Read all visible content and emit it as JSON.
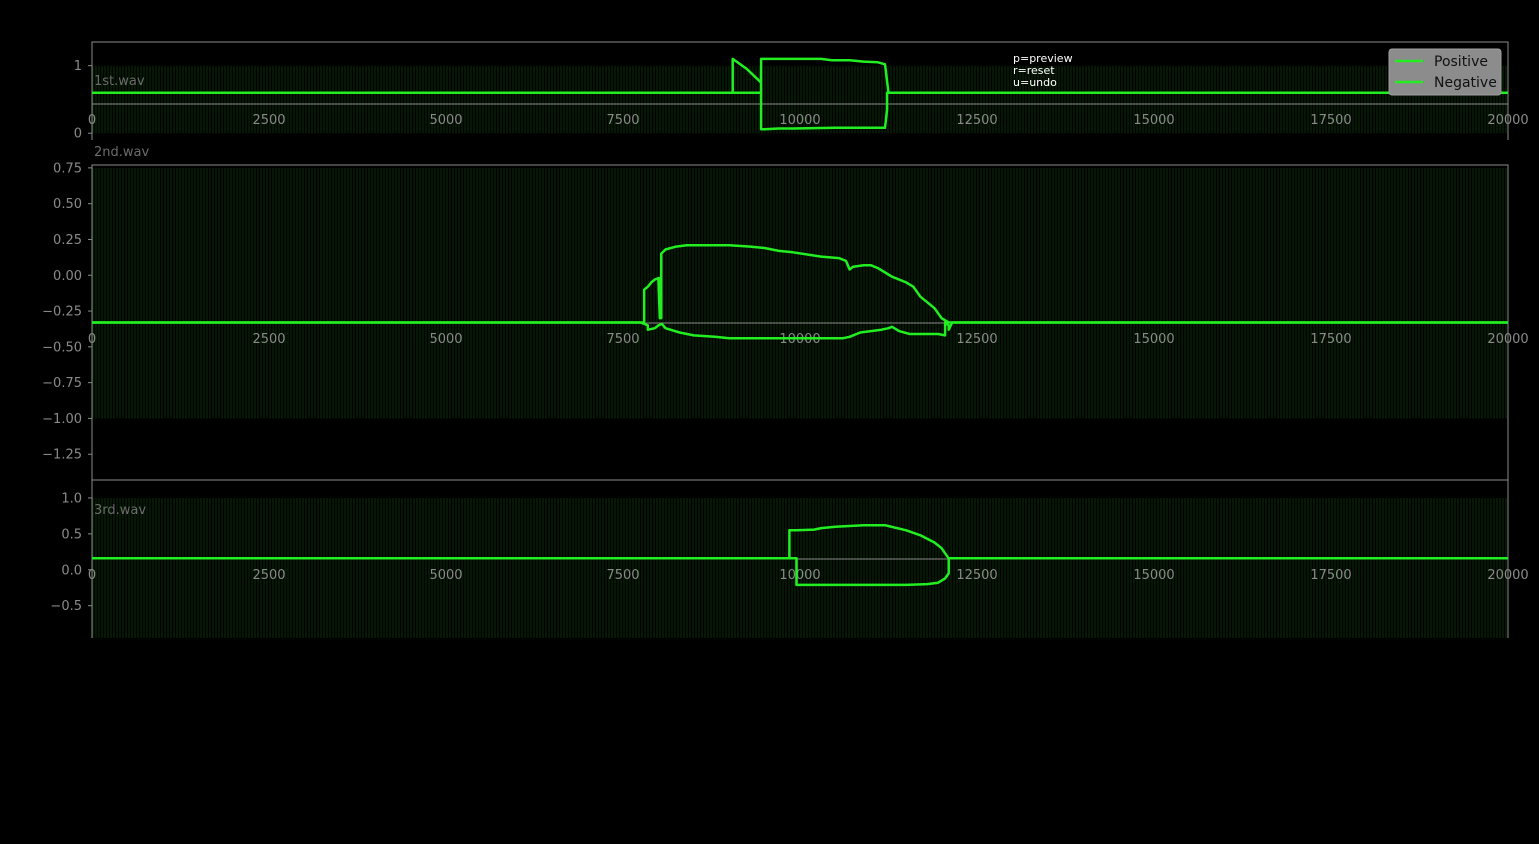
{
  "help_lines": [
    "p=preview",
    "r=reset",
    "u=undo"
  ],
  "colors": {
    "background": "#000000",
    "line": "#22ee22",
    "wave": "#0e5a0e",
    "frame": "#8a8a8a",
    "tick_text": "#8a8a8a",
    "legend_bg": "#8c8c8c"
  },
  "chart_data": [
    {
      "type": "line",
      "title": "1st.wav",
      "x_ticks": [
        0,
        2500,
        5000,
        7500,
        10000,
        12500,
        15000,
        17500,
        20000
      ],
      "x_tick_labels": [
        "0",
        "2500",
        "5000",
        "7500",
        "10000",
        "12500",
        "15000",
        "17500",
        "20000"
      ],
      "y_ticks": [
        1,
        0
      ],
      "y_tick_labels": [
        "1",
        "0"
      ],
      "xlim": [
        0,
        20000
      ],
      "ylim": [
        -0.1,
        1.35
      ],
      "wave_amplitude": [
        0,
        1
      ],
      "legend": {
        "entries": [
          "Positive",
          "Negative"
        ],
        "position": "top-right"
      },
      "series": [
        {
          "name": "Positive",
          "x": [
            0,
            9050,
            9050,
            9250,
            9350,
            9450,
            9450,
            9450,
            9650,
            9650,
            9800,
            9850,
            10300,
            10450,
            10700,
            10900,
            11100,
            11200,
            11250,
            11250,
            11500,
            20000
          ],
          "y": [
            0.6,
            0.6,
            1.1,
            0.95,
            0.85,
            0.75,
            0.6,
            1.1,
            1.1,
            1.1,
            1.1,
            1.1,
            1.1,
            1.08,
            1.08,
            1.06,
            1.05,
            1.02,
            0.6,
            0.6,
            0.6,
            0.6
          ]
        },
        {
          "name": "Negative",
          "x": [
            0,
            9450,
            9450,
            9500,
            9700,
            9900,
            10500,
            11000,
            11200,
            11200,
            11230,
            11230,
            20000
          ],
          "y": [
            0.6,
            0.6,
            0.06,
            0.06,
            0.07,
            0.07,
            0.08,
            0.08,
            0.08,
            0.08,
            0.35,
            0.6,
            0.6
          ]
        }
      ]
    },
    {
      "type": "line",
      "title": "2nd.wav",
      "x_ticks": [
        0,
        2500,
        5000,
        7500,
        10000,
        12500,
        15000,
        17500,
        20000
      ],
      "x_tick_labels": [
        "0",
        "2500",
        "5000",
        "7500",
        "10000",
        "12500",
        "15000",
        "17500",
        "20000"
      ],
      "y_ticks": [
        0.75,
        0.5,
        0.25,
        0.0,
        -0.25,
        -0.5,
        -0.75,
        -1.0,
        -1.25
      ],
      "y_tick_labels": [
        "0.75",
        "0.50",
        "0.25",
        "0.00",
        "−0.25",
        "−0.50",
        "−0.75",
        "−1.00",
        "−1.25"
      ],
      "xlim": [
        0,
        20000
      ],
      "ylim": [
        -1.43,
        0.77
      ],
      "wave_amplitude": [
        -1.0,
        0.75
      ],
      "series": [
        {
          "name": "Positive",
          "x": [
            0,
            7800,
            7800,
            7850,
            7900,
            7950,
            8000,
            8020,
            8020,
            8040,
            8040,
            8100,
            8250,
            8400,
            8800,
            9000,
            9300,
            9500,
            9700,
            9900,
            10300,
            10550,
            10600,
            10650,
            10700,
            10750,
            10900,
            11000,
            11100,
            11300,
            11450,
            11500,
            11600,
            11700,
            11900,
            12000,
            12100,
            12150,
            20000
          ],
          "y": [
            -0.33,
            -0.33,
            -0.1,
            -0.08,
            -0.05,
            -0.03,
            -0.02,
            -0.3,
            -0.02,
            -0.3,
            0.15,
            0.18,
            0.2,
            0.21,
            0.21,
            0.21,
            0.2,
            0.19,
            0.17,
            0.16,
            0.13,
            0.12,
            0.11,
            0.1,
            0.04,
            0.06,
            0.07,
            0.07,
            0.05,
            -0.01,
            -0.04,
            -0.05,
            -0.08,
            -0.15,
            -0.23,
            -0.3,
            -0.33,
            -0.33,
            -0.33
          ]
        },
        {
          "name": "Negative",
          "x": [
            0,
            7750,
            7850,
            7850,
            7950,
            8000,
            8050,
            8100,
            8300,
            8500,
            8800,
            9000,
            10000,
            10600,
            10700,
            10850,
            11000,
            11150,
            11250,
            11300,
            11400,
            11550,
            11800,
            11950,
            12050,
            12050,
            12100,
            12100,
            12150,
            20000
          ],
          "y": [
            -0.33,
            -0.33,
            -0.35,
            -0.38,
            -0.37,
            -0.35,
            -0.34,
            -0.37,
            -0.4,
            -0.42,
            -0.43,
            -0.44,
            -0.44,
            -0.44,
            -0.43,
            -0.4,
            -0.39,
            -0.38,
            -0.37,
            -0.36,
            -0.39,
            -0.41,
            -0.41,
            -0.41,
            -0.42,
            -0.33,
            -0.35,
            -0.38,
            -0.33,
            -0.33
          ]
        }
      ]
    },
    {
      "type": "line",
      "title": "3rd.wav",
      "x_ticks": [
        0,
        2500,
        5000,
        7500,
        10000,
        12500,
        15000,
        17500,
        20000
      ],
      "x_tick_labels": [
        "0",
        "2500",
        "5000",
        "7500",
        "10000",
        "12500",
        "15000",
        "17500",
        "20000"
      ],
      "y_ticks": [
        1.0,
        0.5,
        0.0,
        -0.5
      ],
      "y_tick_labels": [
        "1.0",
        "0.5",
        "0.0",
        "−0.5"
      ],
      "xlim": [
        0,
        20000
      ],
      "ylim": [
        -0.95,
        1.25
      ],
      "wave_amplitude": [
        -0.95,
        1.0
      ],
      "series": [
        {
          "name": "Positive",
          "x": [
            0,
            9850,
            9850,
            9950,
            10200,
            10300,
            10500,
            10900,
            11200,
            11500,
            11700,
            11900,
            12000,
            12050,
            12100,
            20000
          ],
          "y": [
            0.16,
            0.16,
            0.55,
            0.55,
            0.56,
            0.58,
            0.6,
            0.62,
            0.62,
            0.55,
            0.48,
            0.38,
            0.3,
            0.23,
            0.16,
            0.16
          ]
        },
        {
          "name": "Negative",
          "x": [
            0,
            9900,
            9950,
            9950,
            10200,
            11000,
            11500,
            11800,
            11950,
            12050,
            12100,
            12100,
            20000
          ],
          "y": [
            0.16,
            0.16,
            0.16,
            -0.21,
            -0.21,
            -0.21,
            -0.21,
            -0.2,
            -0.18,
            -0.12,
            -0.05,
            0.16,
            0.16
          ]
        }
      ]
    }
  ]
}
